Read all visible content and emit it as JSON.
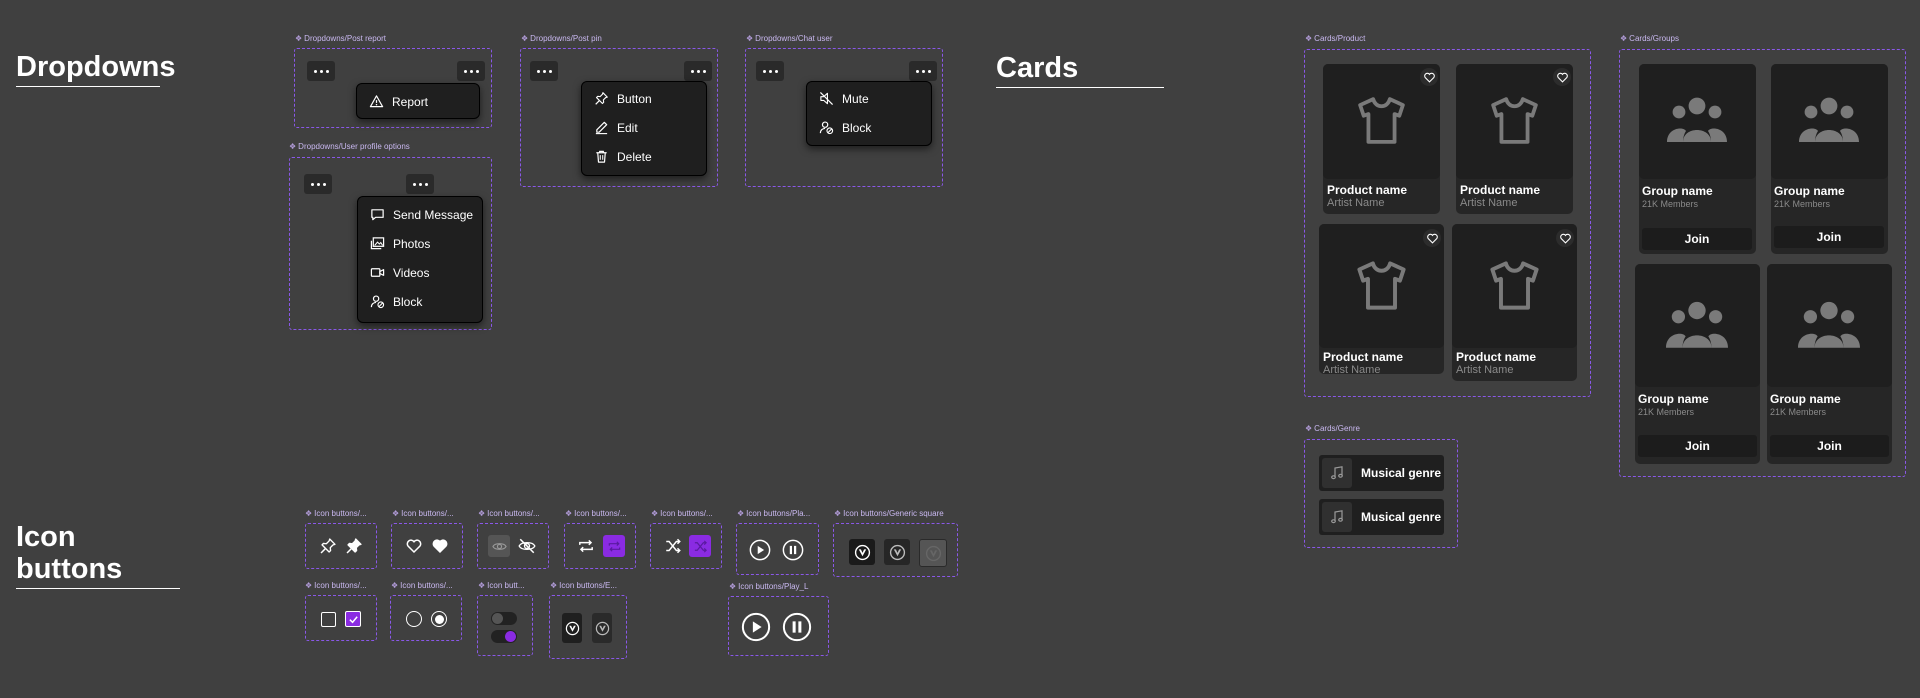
{
  "sections": {
    "dropdowns": "Dropdowns",
    "cards": "Cards",
    "icon_buttons": "Icon buttons"
  },
  "frames": {
    "post_report": "Dropdowns/Post report",
    "user_profile": "Dropdowns/User profile options",
    "post_pin": "Dropdowns/Post pin",
    "chat_user": "Dropdowns/Chat user",
    "cards_product": "Cards/Product",
    "cards_groups": "Cards/Groups",
    "cards_genre": "Cards/Genre",
    "ib_pin": "Icon buttons/...",
    "ib_heart": "Icon buttons/...",
    "ib_eye": "Icon buttons/...",
    "ib_repeat": "Icon buttons/...",
    "ib_shuffle": "Icon buttons/...",
    "ib_play": "Icon buttons/Pla...",
    "ib_generic": "Icon buttons/Generic square",
    "ib_check": "Icon buttons/...",
    "ib_radio": "Icon buttons/...",
    "ib_toggle": "Icon butt...",
    "ib_e": "Icon buttons/E...",
    "ib_play_l": "Icon buttons/Play_L"
  },
  "menus": {
    "report": [
      "Report"
    ],
    "profile": [
      "Send Message",
      "Photos",
      "Videos",
      "Block"
    ],
    "pin": [
      "Button",
      "Edit",
      "Delete"
    ],
    "chat": [
      "Mute",
      "Block"
    ]
  },
  "products": [
    {
      "name": "Product name",
      "artist": "Artist Name"
    },
    {
      "name": "Product name",
      "artist": "Artist Name"
    },
    {
      "name": "Product name",
      "artist": "Artist Name"
    },
    {
      "name": "Product name",
      "artist": "Artist Name"
    }
  ],
  "groups": [
    {
      "name": "Group name",
      "members": "21K Members",
      "join": "Join"
    },
    {
      "name": "Group name",
      "members": "21K Members",
      "join": "Join"
    },
    {
      "name": "Group name",
      "members": "21K Members",
      "join": "Join"
    },
    {
      "name": "Group name",
      "members": "21K Members",
      "join": "Join"
    }
  ],
  "genres": [
    "Musical genre",
    "Musical genre"
  ],
  "colors": {
    "background": "#404040",
    "frame_border": "#8a58e8",
    "accent_purple": "#8a2be2",
    "surface": "#1f1f1f"
  }
}
